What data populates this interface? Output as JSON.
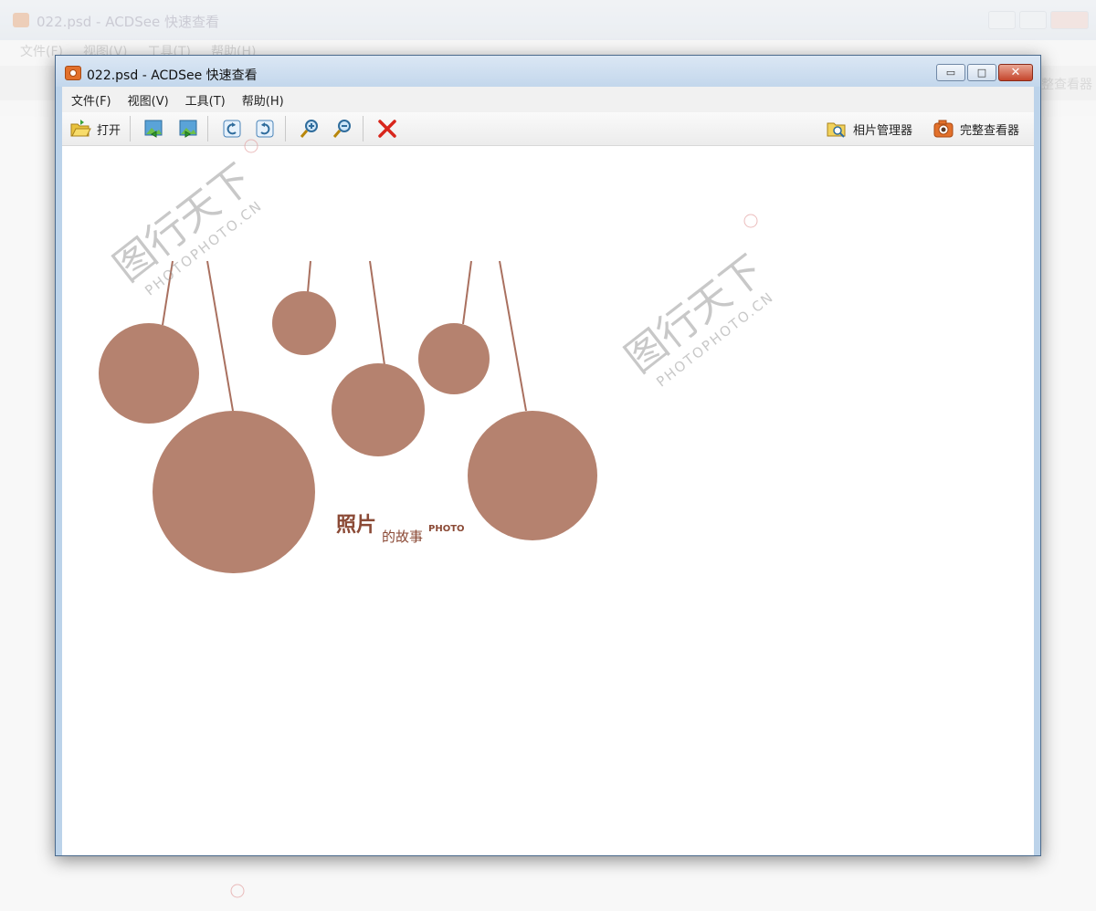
{
  "background_window": {
    "title": "022.psd - ACDSee 快速查看",
    "menu": [
      "文件(F)",
      "视图(V)",
      "工具(T)",
      "帮助(H)"
    ],
    "toolbar_right_label": "完整查看器"
  },
  "window": {
    "title": "022.psd - ACDSee 快速查看",
    "controls": {
      "minimize": "▭",
      "maximize": "□",
      "close": "✕"
    }
  },
  "menu": [
    {
      "label": "文件(F)"
    },
    {
      "label": "视图(V)"
    },
    {
      "label": "工具(T)"
    },
    {
      "label": "帮助(H)"
    }
  ],
  "toolbar": {
    "open_label": "打开",
    "photo_manager_label": "相片管理器",
    "full_viewer_label": "完整查看器",
    "icons": [
      "open-folder-icon",
      "previous-image-icon",
      "next-image-icon",
      "rotate-left-icon",
      "rotate-right-icon",
      "zoom-in-icon",
      "zoom-out-icon",
      "delete-icon",
      "photo-manager-icon",
      "camera-icon"
    ]
  },
  "image": {
    "circle_color": "#b5826f",
    "text_color": "#8b4a36",
    "title_main": "照片",
    "title_sub": "的故事",
    "title_en": "PHOTO"
  },
  "watermark": {
    "text_cn": "图行天下",
    "text_en": "PHOTOPHOTO.CN"
  }
}
